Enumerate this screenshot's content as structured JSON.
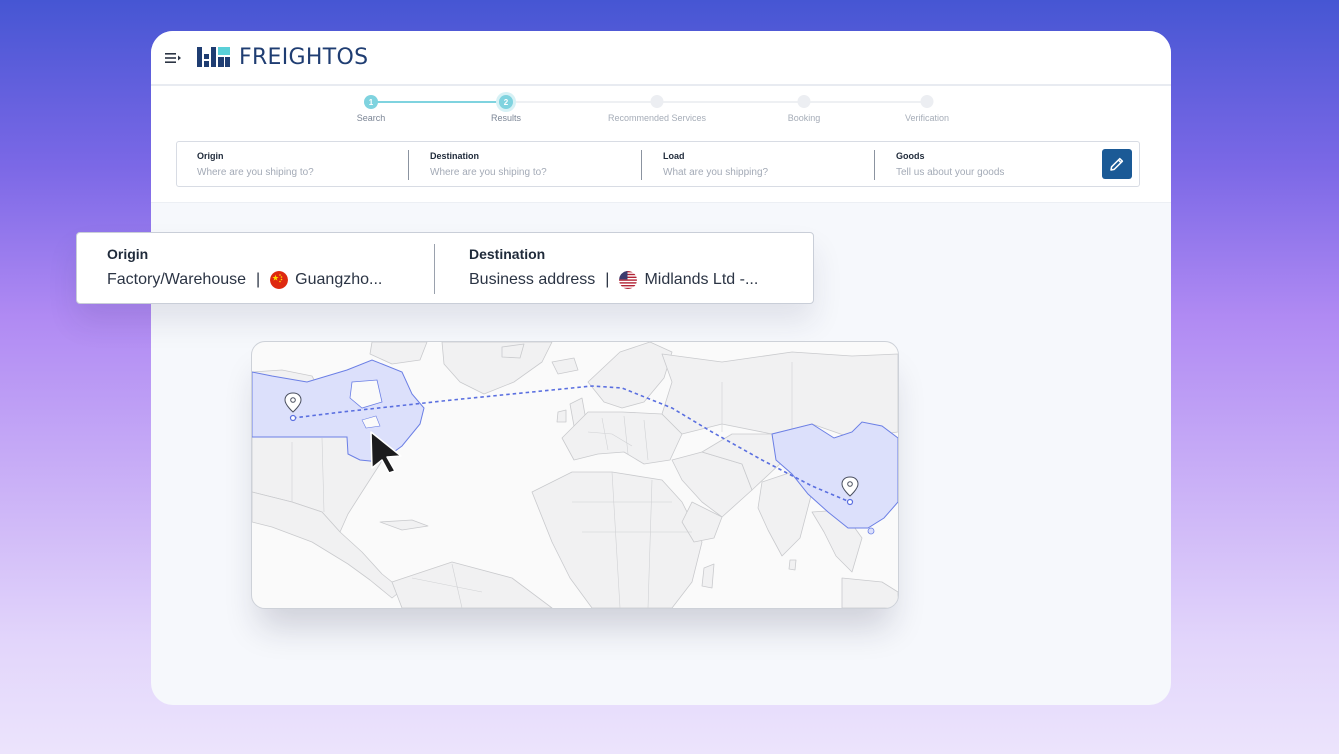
{
  "app": {
    "brand": "FREIGHTOS",
    "brand_color": "#1f3d72",
    "accent": "#7fd3df"
  },
  "stepper": {
    "steps": [
      {
        "number": "1",
        "label": "Search",
        "state": "done"
      },
      {
        "number": "2",
        "label": "Results",
        "state": "current"
      },
      {
        "number": "",
        "label": "Recommended Services",
        "state": "todo"
      },
      {
        "number": "",
        "label": "Booking",
        "state": "todo"
      },
      {
        "number": "",
        "label": "Verification",
        "state": "todo"
      }
    ]
  },
  "search": {
    "origin": {
      "label": "Origin",
      "placeholder": "Where are you shiping to?"
    },
    "destination": {
      "label": "Destination",
      "placeholder": "Where are you shiping to?"
    },
    "load": {
      "label": "Load",
      "placeholder": "What are you shipping?"
    },
    "goods": {
      "label": "Goods",
      "placeholder": "Tell us about your goods"
    },
    "edit_icon": "pencil-icon"
  },
  "route": {
    "origin": {
      "label": "Origin",
      "type": "Factory/Warehouse",
      "separator": "|",
      "place": "Guangzho...",
      "flag": "china-flag-icon"
    },
    "destination": {
      "label": "Destination",
      "type": "Business address",
      "separator": "|",
      "place": "Midlands Ltd -...",
      "flag": "usa-flag-icon"
    }
  },
  "map": {
    "highlight_color": "#d9defa",
    "route_color": "#5a6fe0",
    "origin_pin": "location-pin-icon",
    "destination_pin": "location-pin-icon"
  }
}
